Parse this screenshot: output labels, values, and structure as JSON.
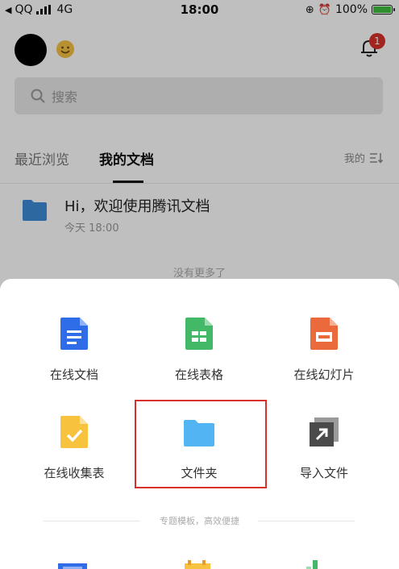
{
  "status_bar": {
    "carrier": "QQ",
    "network": "4G",
    "time": "18:00",
    "battery": "100%"
  },
  "header": {
    "notification_count": "1"
  },
  "search": {
    "placeholder": "搜索"
  },
  "tabs": {
    "recent": "最近浏览",
    "mine": "我的文档",
    "sort_label": "我的"
  },
  "doc_list": [
    {
      "title": "Hi，欢迎使用腾讯文档",
      "time": "今天 18:00"
    }
  ],
  "list_end": "没有更多了",
  "sheet": {
    "items": [
      {
        "label": "在线文档",
        "icon": "doc-icon",
        "color": "#2f6ce8"
      },
      {
        "label": "在线表格",
        "icon": "sheet-icon",
        "color": "#43b866"
      },
      {
        "label": "在线幻灯片",
        "icon": "slide-icon",
        "color": "#ea6a3c"
      },
      {
        "label": "在线收集表",
        "icon": "form-icon",
        "color": "#f7c23e"
      },
      {
        "label": "文件夹",
        "icon": "folder-icon",
        "color": "#52b4f2"
      },
      {
        "label": "导入文件",
        "icon": "import-icon",
        "color": "#555555"
      }
    ],
    "divider_text": "专题模板，高效便捷"
  }
}
